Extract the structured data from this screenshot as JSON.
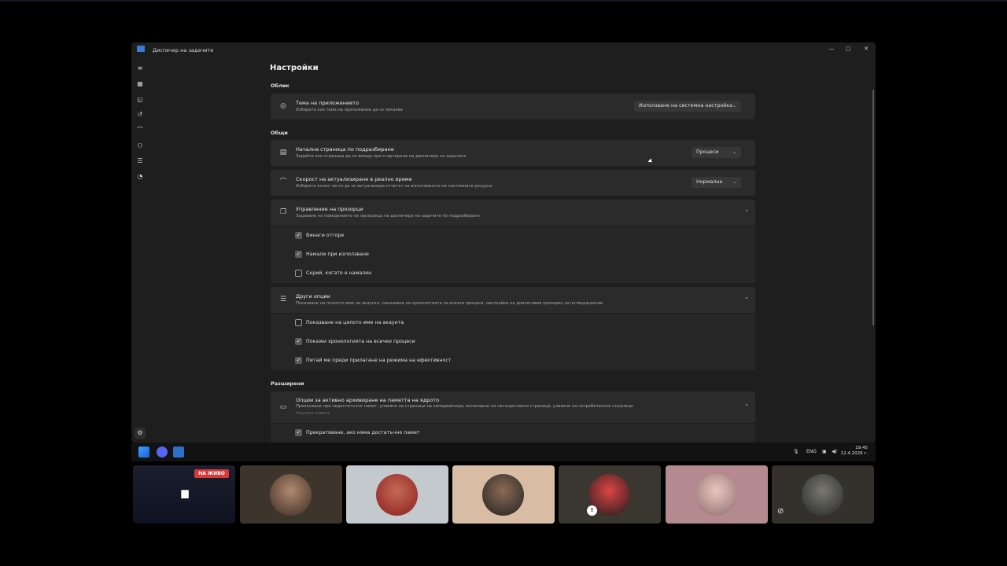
{
  "window": {
    "title": "Диспечер на задачите",
    "controls": [
      "—",
      "▢",
      "✕"
    ]
  },
  "sidebar": {
    "items": [
      {
        "icon": "hamburger-menu-icon",
        "glyph": "≡"
      },
      {
        "icon": "processes-icon",
        "glyph": "▦"
      },
      {
        "icon": "performance-icon",
        "glyph": "◱"
      },
      {
        "icon": "app-history-icon",
        "glyph": "↺"
      },
      {
        "icon": "startup-apps-icon",
        "glyph": "⌒"
      },
      {
        "icon": "users-icon",
        "glyph": "⚇"
      },
      {
        "icon": "details-icon",
        "glyph": "☰"
      },
      {
        "icon": "services-icon",
        "glyph": "◔"
      }
    ],
    "settings_glyph": "⚙"
  },
  "page": {
    "title": "Настройки"
  },
  "sections": {
    "appearance": "Облик",
    "general": "Общи",
    "advanced": "Разширени"
  },
  "theme": {
    "title": "Тема на приложението",
    "subtitle": "Изберете коя тема на приложение да се показва",
    "value": "Използване на системна настройка"
  },
  "start_page": {
    "title": "Начална страница по подразбиране",
    "subtitle": "Задайте коя страница да се вижда при стартиране на диспечера на задачите",
    "value": "Процеси"
  },
  "update_speed": {
    "title": "Скорост на актуализиране в реално време",
    "subtitle": "Изберете колко често да се актуализира отчетът за използването на системните ресурси",
    "value": "Нормална"
  },
  "window_mgmt": {
    "title": "Управление на прозорци",
    "subtitle": "Задаване на поведението на прозореца на диспечера на задачите по подразбиране",
    "options": [
      {
        "label": "Винаги отгоре",
        "checked": true
      },
      {
        "label": "Намали при използване",
        "checked": true
      },
      {
        "label": "Скрий, когато е намален",
        "checked": false
      }
    ]
  },
  "other_options": {
    "title": "Други опции",
    "subtitle": "Показване на пълното име на акаунта, показване на хронологията за всички процеси, настройки на диалоговия прозорец за потвърждение",
    "options": [
      {
        "label": "Показване на цялото име на акаунта",
        "checked": false
      },
      {
        "label": "Покажи хронологията на всички процеси",
        "checked": true
      },
      {
        "label": "Питай ме преди прилагане на режима на ефективност",
        "checked": true
      }
    ]
  },
  "memory": {
    "title": "Опции за активно архивиране на паметта на ядрото",
    "subtitle": "Прекъсване при недостатъчно памет, улавяне на страници на хипервайзора, включване на несъществени страници, улавяне на потребителски страници",
    "subtitle2": "Научете повече",
    "options": [
      {
        "label": "Прекратяване, ако няма достатъчно памет",
        "checked": true
      }
    ]
  },
  "taskbar": {
    "lang": "ENG",
    "time": "19:45",
    "date": "12.4.2026 г."
  },
  "call": {
    "live_badge": "НА ЖИВО"
  },
  "colors": {
    "accent": "#3a7bd5",
    "live": "#d63a3a",
    "window_bg": "#1e1e1e",
    "card_bg": "#2b2b2b"
  }
}
